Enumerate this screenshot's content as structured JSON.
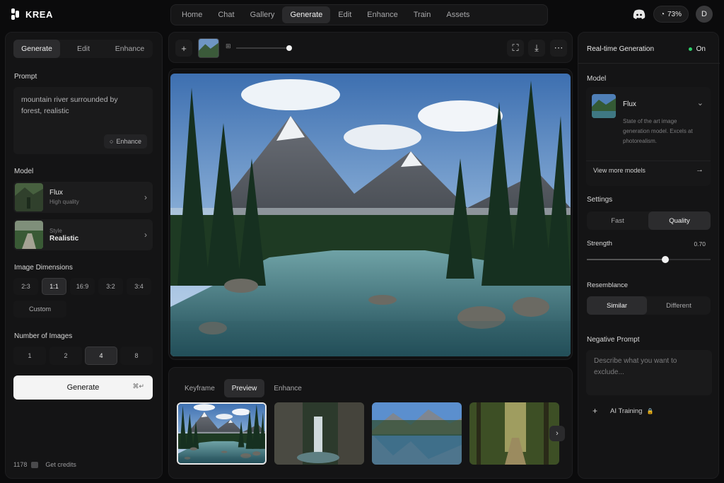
{
  "app": {
    "name": "KREA"
  },
  "nav": {
    "items": [
      "Home",
      "Chat",
      "Gallery",
      "Generate",
      "Edit",
      "Enhance",
      "Train",
      "Assets"
    ],
    "active": "Generate"
  },
  "top_right": {
    "credits_percent": "73%",
    "avatar_initial": "D"
  },
  "left": {
    "mode_tabs": [
      "Generate",
      "Edit",
      "Enhance"
    ],
    "prompt_label": "Prompt",
    "prompt_text": "mountain river surrounded by forest, realistic",
    "enhance_label": "Enhance",
    "model_label": "Model",
    "model": {
      "name": "Flux",
      "subtitle": "High quality"
    },
    "style": {
      "label": "Style",
      "value": "Realistic"
    },
    "dimensions_label": "Image Dimensions",
    "dimensions": [
      "2:3",
      "1:1",
      "16:9",
      "3:2",
      "3:4"
    ],
    "dimension_selected": "1:1",
    "custom_label": "Custom",
    "num_images_label": "Number of Images",
    "num_images": [
      "1",
      "2",
      "4",
      "8"
    ],
    "num_selected": "4",
    "generate_label": "Generate",
    "generate_shortcut": "⌘↵",
    "credits": "1178",
    "get_credits": "Get credits"
  },
  "center": {
    "bottom_tabs": [
      "Keyframe",
      "Preview",
      "Enhance"
    ],
    "bottom_active": "Preview"
  },
  "right": {
    "realtime_label": "Real-time Generation",
    "realtime_state": "On",
    "model_label": "Model",
    "model_name": "Flux",
    "model_desc": "State of the art image generation model. Excels at photorealism.",
    "view_more": "View more models",
    "settings_label": "Settings",
    "settings_options": [
      "Fast",
      "Quality"
    ],
    "settings_selected": "Quality",
    "strength_label": "Strength",
    "strength_value": "0.70",
    "resemblance_label": "Resemblance",
    "resemblance_options": [
      "Similar",
      "Different"
    ],
    "resemblance_selected": "Similar",
    "negative_label": "Negative Prompt",
    "negative_placeholder": "Describe what you want to exclude...",
    "ai_training_label": "AI Training"
  },
  "colors": {
    "accent_green": "#2fd06b",
    "panel": "#141415",
    "background": "#0b0b0c"
  }
}
